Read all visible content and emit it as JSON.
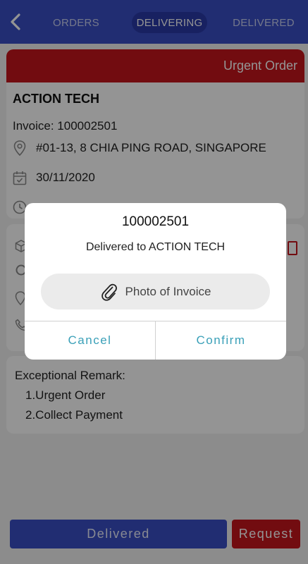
{
  "header": {
    "tabs": [
      {
        "label": "ORDERS"
      },
      {
        "label": "DELIVERING",
        "active": true
      },
      {
        "label": "DELIVERED"
      }
    ]
  },
  "order": {
    "tag": "Urgent Order",
    "company": "ACTION TECH",
    "invoice": "Invoice: 100002501",
    "address": "#01-13, 8 CHIA PING ROAD, SINGAPORE",
    "date": "30/11/2020"
  },
  "remarks": {
    "title": "Exceptional Remark:",
    "items": [
      "1.Urgent Order",
      "2.Collect Payment"
    ]
  },
  "footer": {
    "delivered_label": "Delivered",
    "request_label": "Request"
  },
  "dialog": {
    "title": "100002501",
    "message": "Delivered to ACTION TECH",
    "photo_label": "Photo of Invoice",
    "cancel_label": "Cancel",
    "confirm_label": "Confirm"
  },
  "colors": {
    "brand_blue": "#3a4ec4",
    "urgent_red": "#c4161c",
    "dialog_action": "#3aa0b8"
  },
  "icons": [
    "back-arrow-icon",
    "location-pin-icon",
    "calendar-check-icon",
    "clock-icon",
    "paperclip-icon",
    "box-icon",
    "phone-icon"
  ]
}
